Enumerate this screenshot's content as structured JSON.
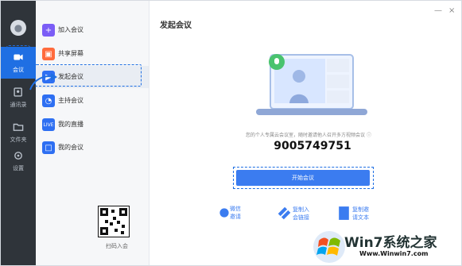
{
  "window": {
    "minimize": "—",
    "close": "×"
  },
  "sidebar": {
    "items": [
      {
        "label": "会议",
        "icon": "video-camera-icon"
      },
      {
        "label": "通讯录",
        "icon": "contacts-icon"
      },
      {
        "label": "文件夹",
        "icon": "folder-icon"
      },
      {
        "label": "设置",
        "icon": "gear-icon"
      }
    ]
  },
  "menu": {
    "items": [
      {
        "label": "加入会议",
        "icon": "plus-icon",
        "color": "#7b5df6"
      },
      {
        "label": "共享屏幕",
        "icon": "share-screen-icon",
        "color": "#ff6b3d"
      },
      {
        "label": "发起会议",
        "icon": "video-camera-icon",
        "color": "#2e6ff2"
      },
      {
        "label": "主持会议",
        "icon": "host-icon",
        "color": "#2e6ff2"
      },
      {
        "label": "我的直播",
        "icon": "live-icon",
        "color": "#2e6ff2"
      },
      {
        "label": "我的会议",
        "icon": "calendar-icon",
        "color": "#2e6ff2"
      }
    ],
    "qr_label": "扫码入会"
  },
  "main": {
    "title": "发起会议",
    "info": "您的个人专属云会议室，随时邀请他人召开多方视频会议 ⓘ",
    "meeting_id": "9005749751",
    "start_button": "开始会议",
    "share_links": [
      {
        "label": "微信邀请",
        "icon": "wechat-icon"
      },
      {
        "label": "复制入会链接",
        "icon": "link-icon"
      },
      {
        "label": "复制邀请文本",
        "icon": "document-icon"
      }
    ]
  },
  "watermark": {
    "brand": "Win7系统之家",
    "url": "Www.Winwin7.com"
  },
  "colors": {
    "accent": "#1f6fe3",
    "sidebar": "#2f343a",
    "button": "#3b7cf0"
  }
}
